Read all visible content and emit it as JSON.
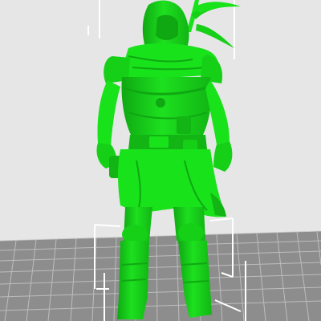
{
  "viewport": {
    "background": "#e6e6e6",
    "bed_color": "#8d8d8d",
    "bed_line_color": "#c9c9c9",
    "model_color": "#18e21a",
    "model_dark": "#0fa812",
    "bounding_box_color": "#ffffff",
    "model_icon": "armored-hooded-warrior-figure"
  }
}
